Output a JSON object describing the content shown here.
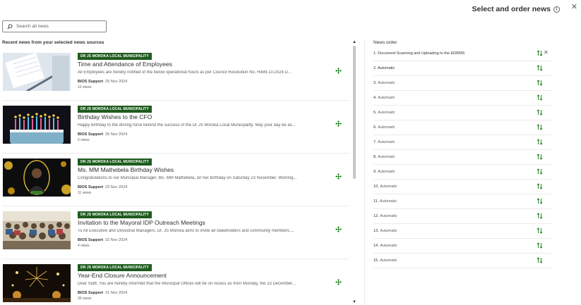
{
  "header": {
    "title": "Select and order news",
    "info_icon": "info-icon",
    "close_icon": "close-icon",
    "close_glyph": "✕",
    "info_glyph": "i"
  },
  "search": {
    "placeholder": "Search all news",
    "value": "",
    "icon": "search-icon"
  },
  "news_section": {
    "title": "Recent news from your selected news sources",
    "items": [
      {
        "source": "DR JS MOROKA LOCAL MUNICIPALITY",
        "title": "Time and Attendance of Employees",
        "description": "All Employees are hereby notified of the below operational hours as per Council Resolution No. R489.10.2024 D...",
        "author": "BIOS Support",
        "date": "29 Nov 2024",
        "views": "10 views",
        "thumbnail": "notebook-image"
      },
      {
        "source": "DR JS MOROKA LOCAL MUNICIPALITY",
        "title": "Birthday Wishes to the CFO",
        "description": "Happy birthday to the driving force behind the success of the Dr JS Moroka Local Municipality.  May your day be as...",
        "author": "BIOS Support",
        "date": "26 Nov 2024",
        "views": "6 views",
        "thumbnail": "birthday-cake-image"
      },
      {
        "source": "DR JS MOROKA LOCAL MUNICIPALITY",
        "title": "Ms. MM Mathebela Birthday Wishes",
        "description": "Congratulations to our Municipal Manager, Ms. MM Mathebela, on her Birthday on Saturday 23 November. Wishing...",
        "author": "BIOS Support",
        "date": "23 Nov 2024",
        "views": "11 views",
        "thumbnail": "portrait-image"
      },
      {
        "source": "DR JS MOROKA LOCAL MUNICIPALITY",
        "title": "Invitation to the Mayoral IDP Outreach Meetings",
        "description": "To All Executive and Divisional Managers, Dr. JS Moroka aims to invite all stakeholders and community members,...",
        "author": "BIOS Support",
        "date": "22 Nov 2024",
        "views": "4 views",
        "thumbnail": "crowd-image"
      },
      {
        "source": "DR JS MOROKA LOCAL MUNICIPALITY",
        "title": "Year-End Closure Announcement",
        "description": "Dear Staff, You are hereby informed that the Municipal Offices will be on recess as from Monday, the 23 December...",
        "author": "BIOS Support",
        "date": "21 Nov 2024",
        "views": "30 views",
        "thumbnail": "fireworks-image"
      }
    ],
    "add_icon": "move-add-icon"
  },
  "scrollbar": {
    "up_glyph": "▲",
    "down_glyph": "▼"
  },
  "order_panel": {
    "title": "News order",
    "rows": [
      {
        "num": "1.",
        "label": "Document Scanning and Uploading to the EDRMS",
        "style": "plain"
      },
      {
        "num": "2.",
        "label": "Automatic",
        "style": "plain"
      },
      {
        "num": "3.",
        "label": "Automatic",
        "style": "italic"
      },
      {
        "num": "4.",
        "label": "Automatic",
        "style": "italic"
      },
      {
        "num": "5.",
        "label": "Automatic",
        "style": "italic"
      },
      {
        "num": "6.",
        "label": "Automatic",
        "style": "italic"
      },
      {
        "num": "7.",
        "label": "Automatic",
        "style": "italic"
      },
      {
        "num": "8.",
        "label": "Automatic",
        "style": "italic"
      },
      {
        "num": "9.",
        "label": "Automatic",
        "style": "italic"
      },
      {
        "num": "10.",
        "label": "Automatic",
        "style": "italic"
      },
      {
        "num": "11.",
        "label": "Automatic",
        "style": "italic"
      },
      {
        "num": "12.",
        "label": "Automatic",
        "style": "italic"
      },
      {
        "num": "13.",
        "label": "Automatic",
        "style": "italic"
      },
      {
        "num": "14.",
        "label": "Automatic",
        "style": "italic"
      },
      {
        "num": "15.",
        "label": "Automatic",
        "style": "italic"
      }
    ],
    "reorder_icon": "reorder-arrows-icon",
    "remove_icon": "remove-icon",
    "remove_glyph": "✕"
  },
  "colors": {
    "badge": "#1e5c1e",
    "accent_icon": "#107c10",
    "divider": "#edebe9",
    "text": "#323130",
    "muted": "#605e5c"
  }
}
